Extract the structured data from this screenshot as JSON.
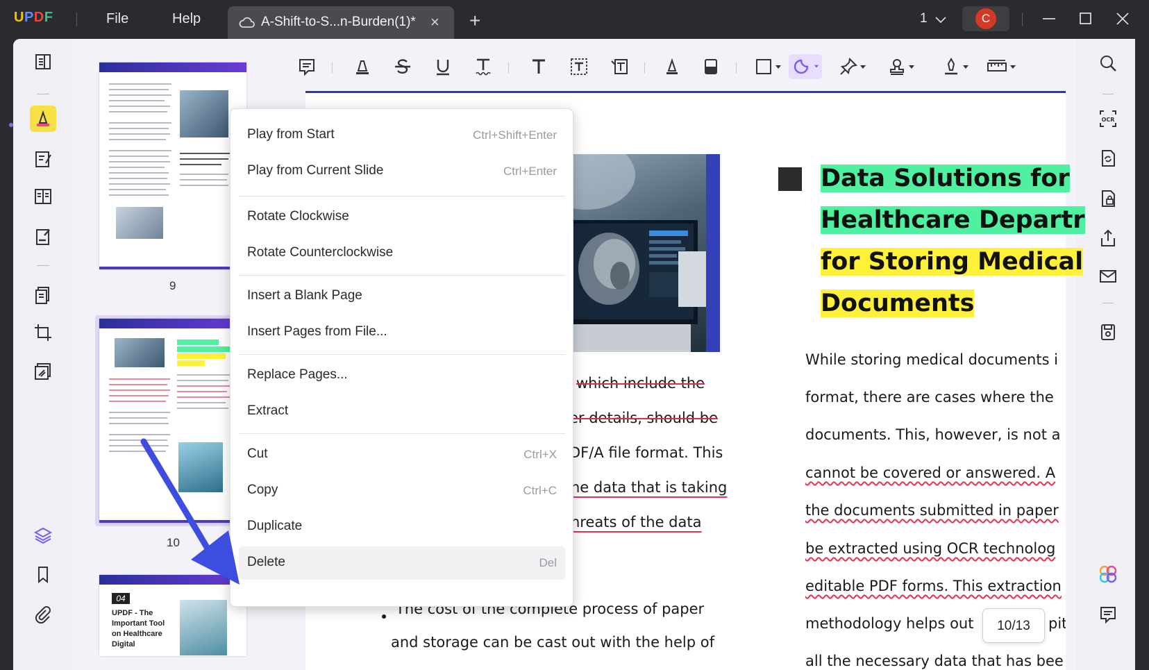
{
  "app": {
    "logo": "UPDF",
    "menu": {
      "file": "File",
      "help": "Help"
    },
    "tab_title": "A-Shift-to-S...n-Burden(1)*",
    "tab_close": "×",
    "tab_add": "+",
    "page_count": "1",
    "avatar_letter": "C"
  },
  "thumbnails": {
    "page9_number": "9",
    "page10_number": "10",
    "page11": {
      "badge": "04",
      "title": "UPDF - The Important Tool on Healthcare Digital"
    }
  },
  "context_menu": {
    "items": [
      {
        "label": "Play from Start",
        "shortcut": "Ctrl+Shift+Enter"
      },
      {
        "label": "Play from Current Slide",
        "shortcut": "Ctrl+Enter"
      },
      {
        "label": "Rotate Clockwise",
        "shortcut": ""
      },
      {
        "label": "Rotate Counterclockwise",
        "shortcut": ""
      },
      {
        "label": "Insert a Blank Page",
        "shortcut": ""
      },
      {
        "label": "Insert Pages from File...",
        "shortcut": ""
      },
      {
        "label": "Replace Pages...",
        "shortcut": ""
      },
      {
        "label": "Extract",
        "shortcut": ""
      },
      {
        "label": "Cut",
        "shortcut": "Ctrl+X"
      },
      {
        "label": "Copy",
        "shortcut": "Ctrl+C"
      },
      {
        "label": "Duplicate",
        "shortcut": ""
      },
      {
        "label": "Delete",
        "shortcut": "Del"
      }
    ]
  },
  "document": {
    "heading_lines": [
      "Data Solutions for",
      "Healthcare Departr",
      "for Storing Medical",
      "Documents"
    ],
    "left_column_lines": [
      "which include the",
      "er details, should be",
      "DF/A file format. This",
      "he data that is taking",
      "hreats of the data"
    ],
    "left_bullet_lines": [
      "The cost of the complete process of paper",
      "and storage can be cast out with the help of"
    ],
    "right_column_lines": [
      "While storing medical documents i",
      "format, there are cases where the",
      "documents. This, however, is not a",
      "cannot be covered or answered. A",
      "the documents submitted in paper",
      "be extracted using OCR technolog",
      "editable PDF forms. This extraction",
      "methodology helps out",
      "all the necessary data that has bee"
    ],
    "right_line_8_tail": "pita",
    "page_indicator": "10/13"
  },
  "colors": {
    "accent": "#8a6cf3",
    "highlight_green": "#4ff0a0",
    "highlight_yellow": "#fff13a",
    "avatar": "#d23a26",
    "annotation_red": "#e8304f"
  }
}
